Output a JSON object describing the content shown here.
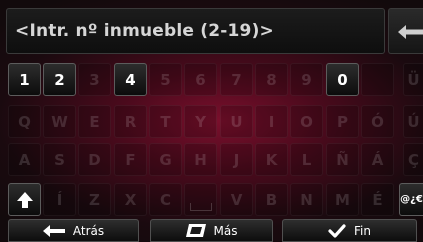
{
  "input": {
    "text": "<Intr. nº inmueble (2-19)>"
  },
  "icons": {
    "backspace": "backspace-arrow-icon",
    "shift": "shift-up-arrow-icon",
    "back": "left-arrow-icon",
    "more": "keyboard-layout-icon",
    "done": "checkmark-icon",
    "space": "space-bar-icon"
  },
  "keys": {
    "row1": [
      "1",
      "2",
      "3",
      "4",
      "5",
      "6",
      "7",
      "8",
      "9",
      "0",
      "",
      "Ü"
    ],
    "row2": [
      "Q",
      "W",
      "E",
      "R",
      "T",
      "Y",
      "U",
      "I",
      "O",
      "P",
      "Ó",
      "Ú"
    ],
    "row3": [
      "A",
      "S",
      "D",
      "F",
      "G",
      "H",
      "J",
      "K",
      "L",
      "Ñ",
      "Á",
      "Ç"
    ],
    "row4": [
      "Í",
      "Z",
      "X",
      "C",
      "V",
      "B",
      "N",
      "M",
      "É"
    ],
    "symbols": "@¿€"
  },
  "buttons": {
    "back": "Atrás",
    "more": "Más",
    "done": "Fin"
  }
}
